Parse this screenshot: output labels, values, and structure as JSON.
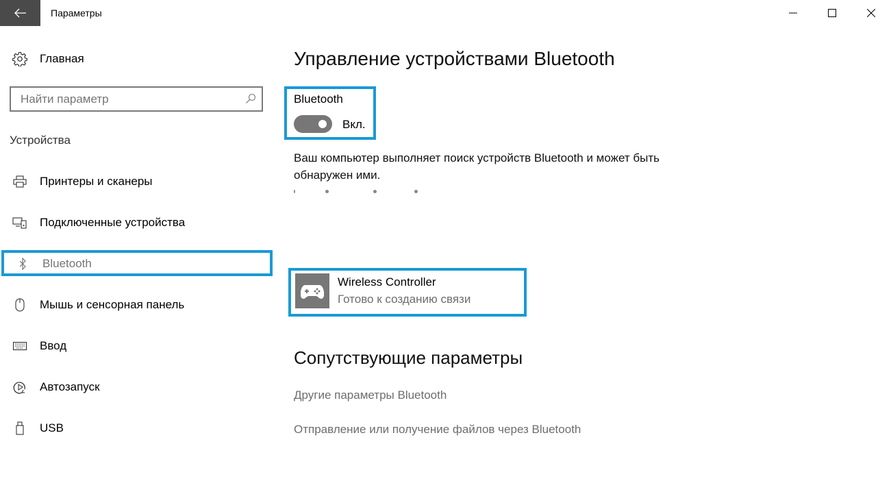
{
  "window": {
    "title": "Параметры",
    "controls": {
      "minimize": "minimize-icon",
      "maximize": "maximize-icon",
      "close": "close-icon"
    },
    "back_icon": "arrow-left-icon"
  },
  "sidebar": {
    "home": {
      "label": "Главная",
      "icon": "gear-icon"
    },
    "search": {
      "placeholder": "Найти параметр",
      "value": "",
      "icon": "search-icon"
    },
    "section_label": "Устройства",
    "items": [
      {
        "label": "Принтеры и сканеры",
        "icon": "printer-icon",
        "active": false
      },
      {
        "label": "Подключенные устройства",
        "icon": "connected-devices-icon",
        "active": false
      },
      {
        "label": "Bluetooth",
        "icon": "bluetooth-icon",
        "active": true
      },
      {
        "label": "Мышь и сенсорная панель",
        "icon": "mouse-icon",
        "active": false
      },
      {
        "label": "Ввод",
        "icon": "keyboard-icon",
        "active": false
      },
      {
        "label": "Автозапуск",
        "icon": "autoplay-icon",
        "active": false
      },
      {
        "label": "USB",
        "icon": "usb-icon",
        "active": false
      }
    ]
  },
  "main": {
    "title": "Управление устройствами Bluetooth",
    "bluetooth_toggle": {
      "label": "Bluetooth",
      "state_label": "Вкл.",
      "on": true
    },
    "description": "Ваш компьютер выполняет поиск устройств Bluetooth и может быть обнаружен ими.",
    "device": {
      "name": "Wireless Controller",
      "status": "Готово к созданию связи",
      "icon": "gamepad-icon"
    },
    "related": {
      "title": "Сопутствующие параметры",
      "links": [
        "Другие параметры Bluetooth",
        "Отправление или получение файлов через Bluetooth"
      ]
    }
  },
  "colors": {
    "highlight": "#1a9ad6",
    "back_button_bg": "#4a4a4a",
    "toggle_bg": "#777777",
    "secondary_text": "#6d6d6d"
  }
}
